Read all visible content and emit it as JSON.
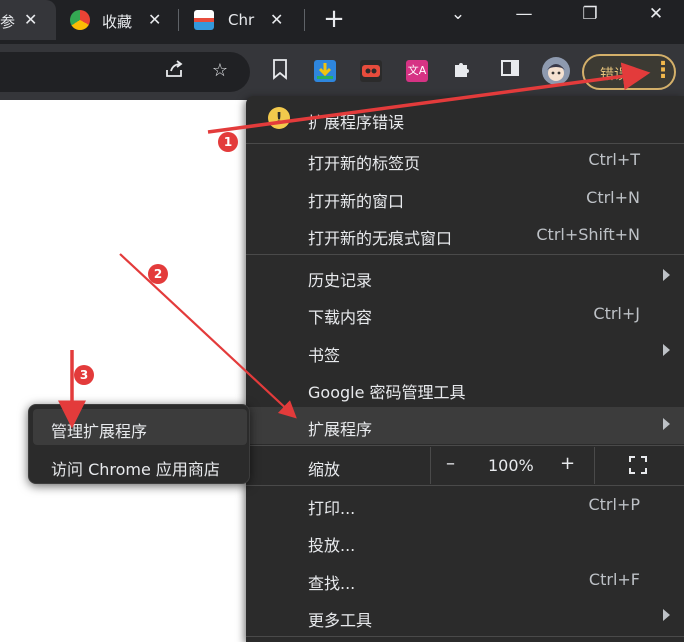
{
  "tabs": [
    {
      "title": "参",
      "active": true
    },
    {
      "title": "收藏",
      "active": false
    },
    {
      "title": "Chr",
      "active": false
    }
  ],
  "window_controls": {
    "dropdown": "⌄",
    "minimize": "—",
    "restore": "❐",
    "close": "✕"
  },
  "toolbar": {
    "error_chip_label": "错误",
    "icons": [
      "share-icon",
      "star-icon",
      "bookmark-icon",
      "download-ext-icon",
      "red-ext-icon",
      "pink-ext-icon",
      "puzzle-icon",
      "sidepanel-icon",
      "avatar-icon",
      "kebab-icon"
    ]
  },
  "menu": {
    "error_item": "扩展程序错误",
    "items": [
      {
        "label": "打开新的标签页",
        "shortcut": "Ctrl+T"
      },
      {
        "label": "打开新的窗口",
        "shortcut": "Ctrl+N"
      },
      {
        "label": "打开新的无痕式窗口",
        "shortcut": "Ctrl+Shift+N"
      },
      {
        "label": "历史记录",
        "shortcut": ""
      },
      {
        "label": "下载内容",
        "shortcut": "Ctrl+J"
      },
      {
        "label": "书签",
        "shortcut": ""
      },
      {
        "label": "Google 密码管理工具",
        "shortcut": ""
      },
      {
        "label": "扩展程序",
        "shortcut": ""
      },
      {
        "label": "打印...",
        "shortcut": "Ctrl+P"
      },
      {
        "label": "投放...",
        "shortcut": ""
      },
      {
        "label": "查找...",
        "shortcut": "Ctrl+F"
      },
      {
        "label": "更多工具",
        "shortcut": ""
      }
    ],
    "zoom": {
      "label": "缩放",
      "minus": "–",
      "value": "100%",
      "plus": "+"
    }
  },
  "submenu": {
    "items": [
      {
        "label": "管理扩展程序"
      },
      {
        "label": "访问 Chrome 应用商店"
      }
    ]
  },
  "annotations": {
    "step1": "1",
    "step2": "2",
    "step3": "3"
  },
  "colors": {
    "arrow": "#e33b3b",
    "accent": "#f2b84c",
    "menu_bg": "#2b2b2b"
  }
}
